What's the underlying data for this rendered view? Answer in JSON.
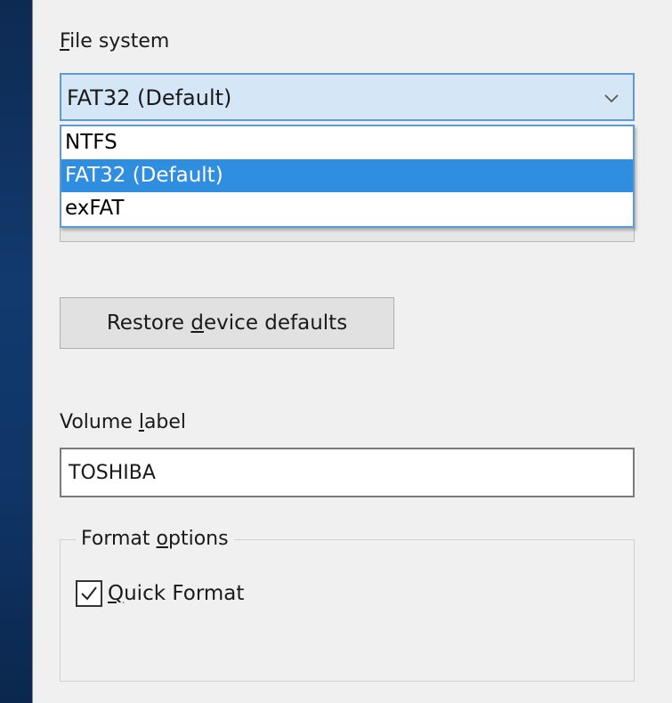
{
  "file_system": {
    "label": "File system",
    "label_access_key": "F",
    "label_rest": "ile system",
    "selected_value": "FAT32 (Default)",
    "options": [
      {
        "label": "NTFS",
        "highlighted": false
      },
      {
        "label": "FAT32 (Default)",
        "highlighted": true
      },
      {
        "label": "exFAT",
        "highlighted": false
      }
    ]
  },
  "restore_button": {
    "label_before": "Restore ",
    "label_access_key": "d",
    "label_after": "evice defaults"
  },
  "volume_label": {
    "label_before": "Volume ",
    "label_access_key": "l",
    "label_after": "abel",
    "value": "TOSHIBA"
  },
  "format_options": {
    "legend_before": "Format ",
    "legend_access_key": "o",
    "legend_after": "ptions",
    "quick_format": {
      "label_access_key": "Q",
      "label_rest": "uick Format",
      "checked": true
    }
  },
  "colors": {
    "highlight": "#2f8ee0",
    "select_border": "#5a9ad6",
    "dialog_bg": "#f0f0f0",
    "desktop_bg": "#123a6e"
  },
  "icons": {
    "dropdown_arrow": "chevron-down-icon",
    "check": "checkmark-icon"
  }
}
